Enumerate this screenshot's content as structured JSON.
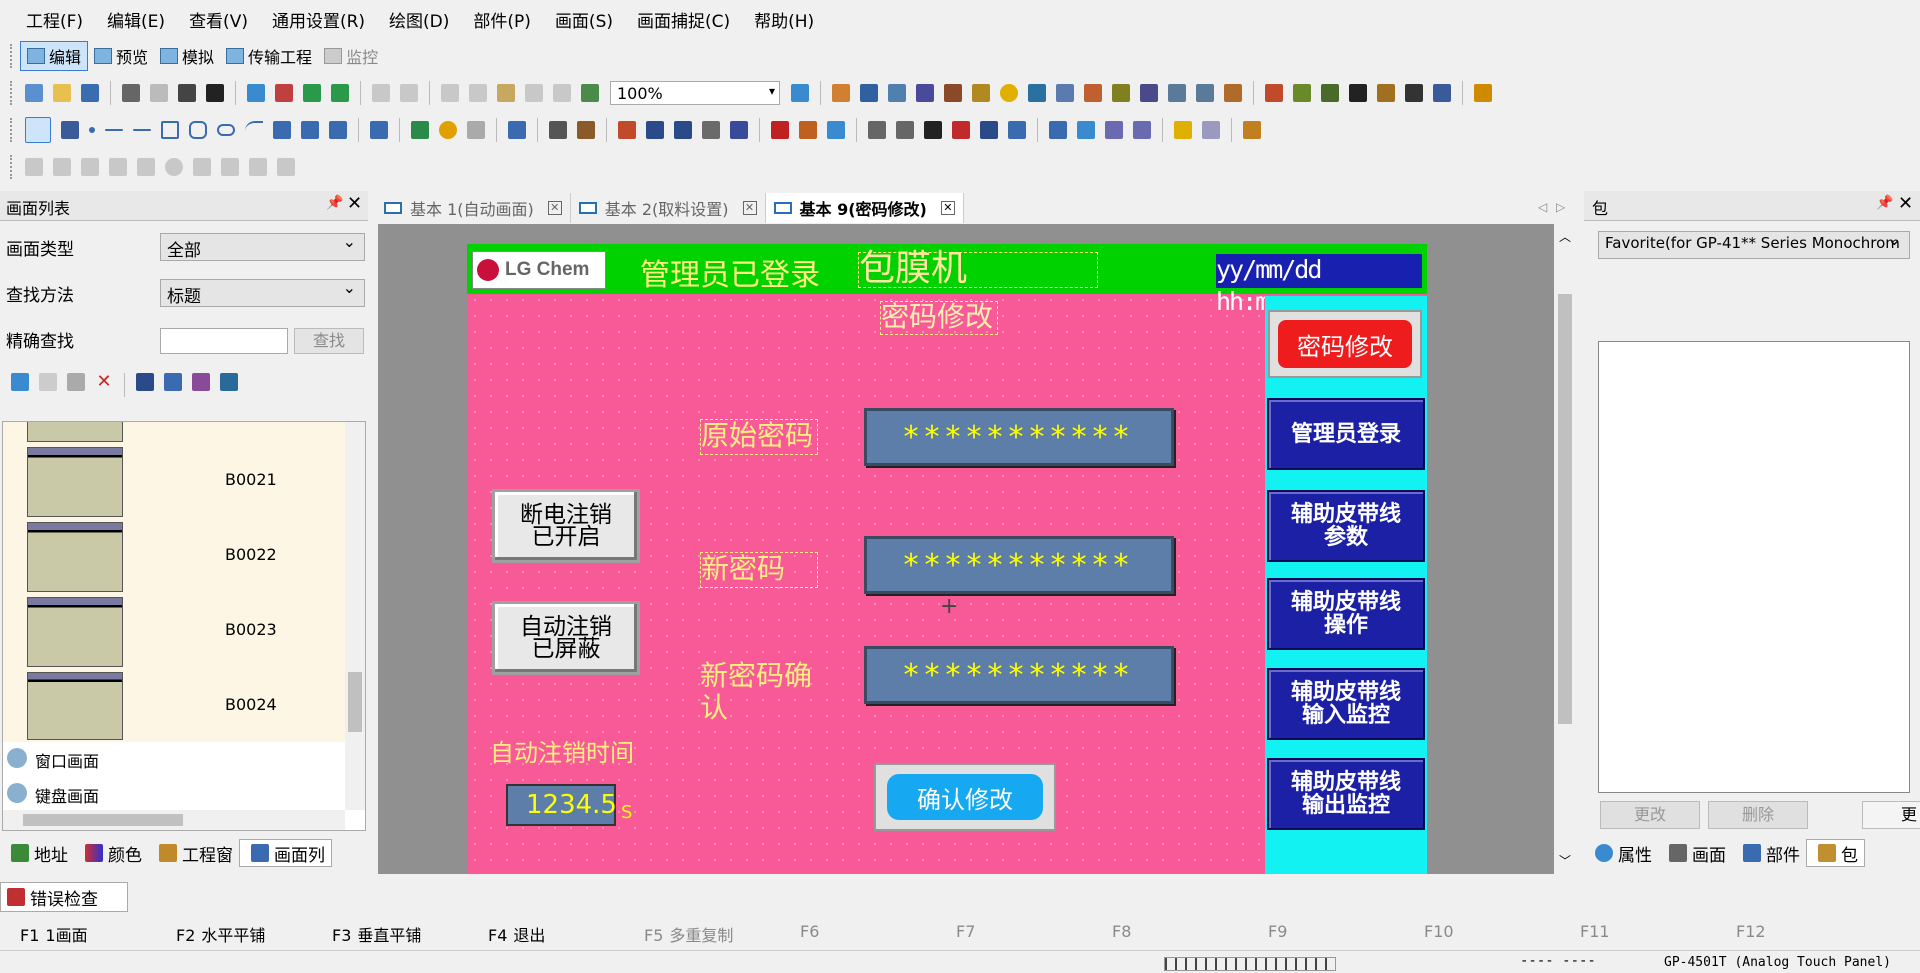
{
  "menu": [
    "工程(F)",
    "编辑(E)",
    "查看(V)",
    "通用设置(R)",
    "绘图(D)",
    "部件(P)",
    "画面(S)",
    "画面捕捉(C)",
    "帮助(H)"
  ],
  "mode_toolbar": {
    "edit": "编辑",
    "preview": "预览",
    "simulate": "模拟",
    "transfer": "传输工程",
    "monitor": "监控"
  },
  "zoom_value": "100%",
  "left_panel": {
    "title": "画面列表",
    "screen_type_label": "画面类型",
    "screen_type_value": "全部",
    "search_method_label": "查找方法",
    "search_method_value": "标题",
    "exact_search_label": "精确查找",
    "search_button": "查找",
    "items": [
      {
        "label": "B0021"
      },
      {
        "label": "B0022"
      },
      {
        "label": "B0023"
      },
      {
        "label": "B0024"
      }
    ],
    "tree_window": "窗口画面",
    "tree_keyboard": "键盘画面",
    "bottom_tabs": [
      "地址",
      "颜色",
      "工程窗",
      "画面列"
    ]
  },
  "doc_tabs": [
    {
      "label": "基本 1(自动画面)"
    },
    {
      "label": "基本 2(取料设置)"
    },
    {
      "label": "基本 9(密码修改)"
    }
  ],
  "hmi": {
    "logo": "LG Chem",
    "admin_status": "管理员已登录",
    "machine_name": "包膜机",
    "datetime": "yy/mm/dd hh:mm:ss",
    "screen_title": "密码修改",
    "old_pw_label": "原始密码",
    "new_pw_label": "新密码",
    "confirm_pw_label": "新密码确认",
    "pw_mask": "***********",
    "power_btn": "断电注销\n已开启",
    "auto_btn": "自动注销\n已屏蔽",
    "auto_time_label": "自动注销时间",
    "auto_time_value": "1234.5",
    "auto_time_unit": "S",
    "confirm_btn": "确认修改",
    "nav": [
      "密码修改",
      "管理员登录",
      "辅助皮带线\n参数",
      "辅助皮带线\n操作",
      "辅助皮带线\n输入监控",
      "辅助皮带线\n输出监控"
    ]
  },
  "right_panel": {
    "title": "包",
    "combo_value": "Favorite(for GP-41** Series Monochrom",
    "change_btn": "更改",
    "delete_btn": "删除",
    "more_btn": "更",
    "bottom_tabs": [
      "属性",
      "画面",
      "部件",
      "包"
    ]
  },
  "error_check": "错误检查",
  "fkeys": [
    {
      "key": "F1",
      "label": "1画面"
    },
    {
      "key": "F2",
      "label": "水平平铺"
    },
    {
      "key": "F3",
      "label": "垂直平铺"
    },
    {
      "key": "F4",
      "label": "退出"
    },
    {
      "key": "F5",
      "label": "多重复制"
    },
    {
      "key": "F6",
      "label": ""
    },
    {
      "key": "F7",
      "label": ""
    },
    {
      "key": "F8",
      "label": ""
    },
    {
      "key": "F9",
      "label": ""
    },
    {
      "key": "F10",
      "label": ""
    },
    {
      "key": "F11",
      "label": ""
    },
    {
      "key": "F12",
      "label": ""
    }
  ],
  "status": {
    "coords": "---- ----",
    "model": "GP-4501T (Analog Touch Panel)"
  }
}
